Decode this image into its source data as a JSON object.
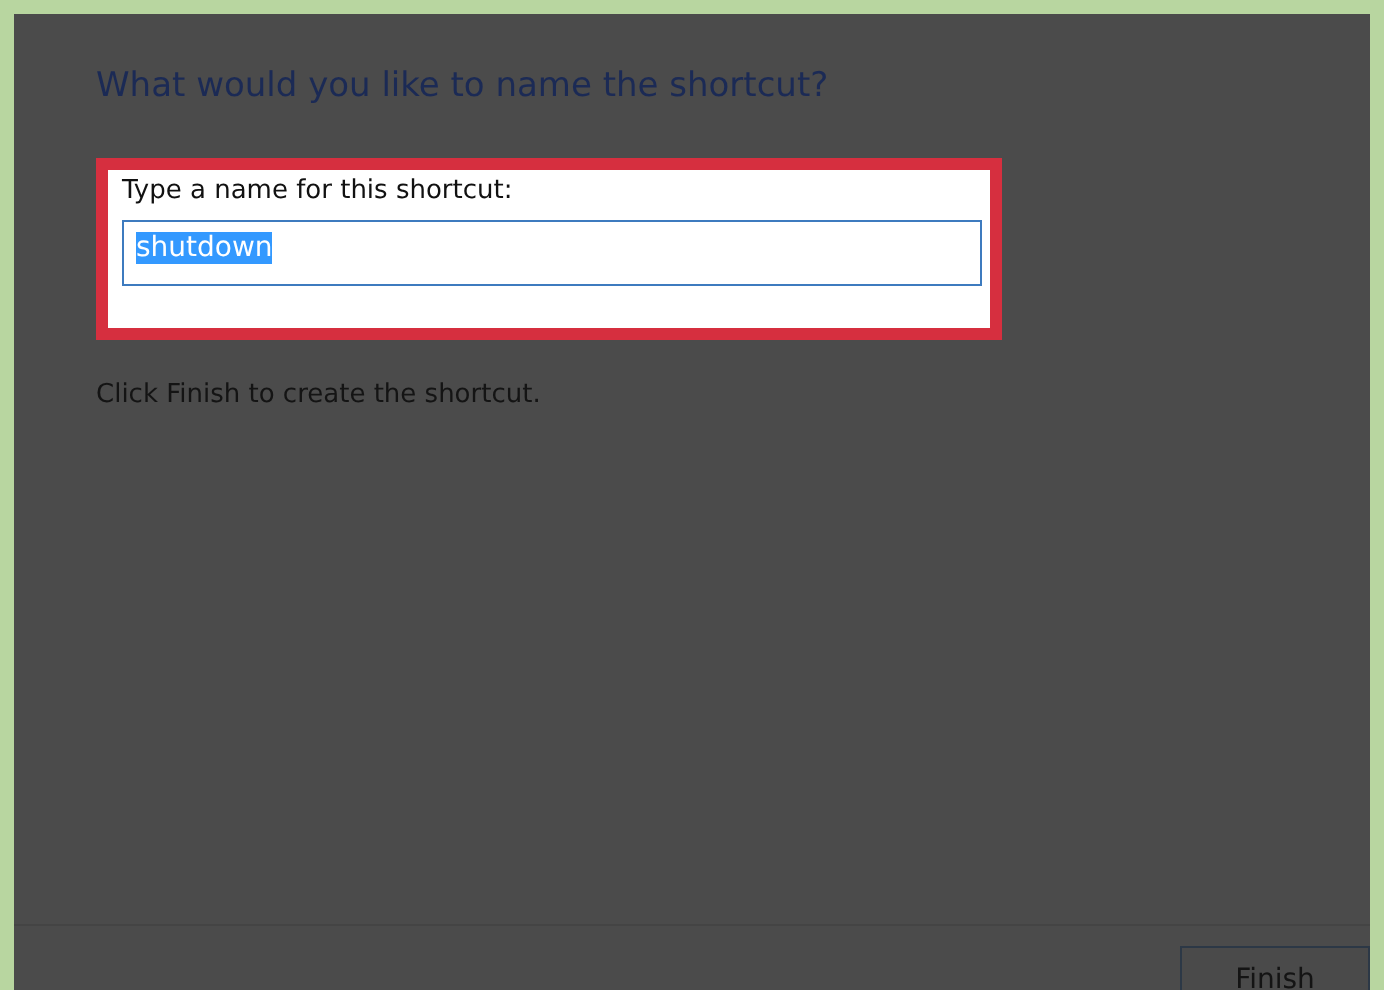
{
  "dialog": {
    "heading": "What would you like to name the shortcut?",
    "field": {
      "label": "Type a name for this shortcut:",
      "value": "shutdown",
      "text_selected": true,
      "highlighted": true
    },
    "instruction": "Click Finish to create the shortcut.",
    "buttons": [
      {
        "label": "Finish"
      }
    ]
  }
}
